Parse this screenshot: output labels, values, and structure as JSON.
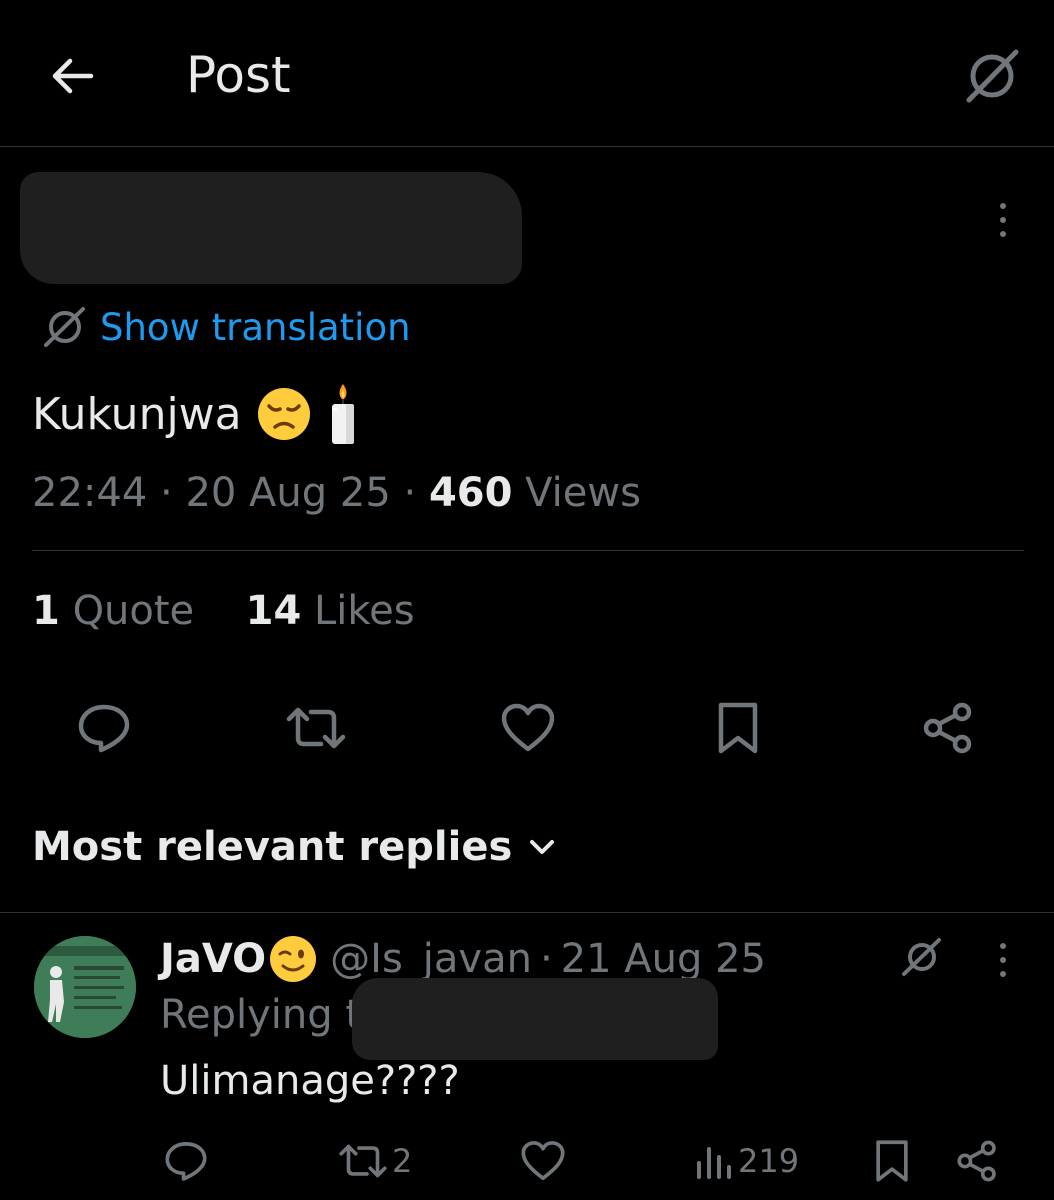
{
  "header": {
    "title": "Post"
  },
  "post": {
    "translate_label": "Show translation",
    "text": "Kukunjwa",
    "emojis": [
      "disappointed-face",
      "candle"
    ],
    "time": "22:44",
    "sep1": "·",
    "date": "20 Aug 25",
    "sep2": "·",
    "views_count": "460",
    "views_label": "Views",
    "quotes_count": "1",
    "quotes_label": "Quote",
    "likes_count": "14",
    "likes_label": "Likes"
  },
  "replies": {
    "sort_label": "Most relevant replies",
    "items": [
      {
        "name": "JaVO",
        "name_emoji": "winking-face",
        "handle": "@Is_javan",
        "sep": "·",
        "date": "21 Aug 25",
        "replying_prefix": "Replying t",
        "text": "Ulimanage????",
        "reposts": "2",
        "views": "219"
      }
    ]
  },
  "colors": {
    "background": "#000000",
    "text": "#e7e9ea",
    "muted": "#71767b",
    "accent": "#1d9bf0",
    "divider": "#2f3336"
  }
}
